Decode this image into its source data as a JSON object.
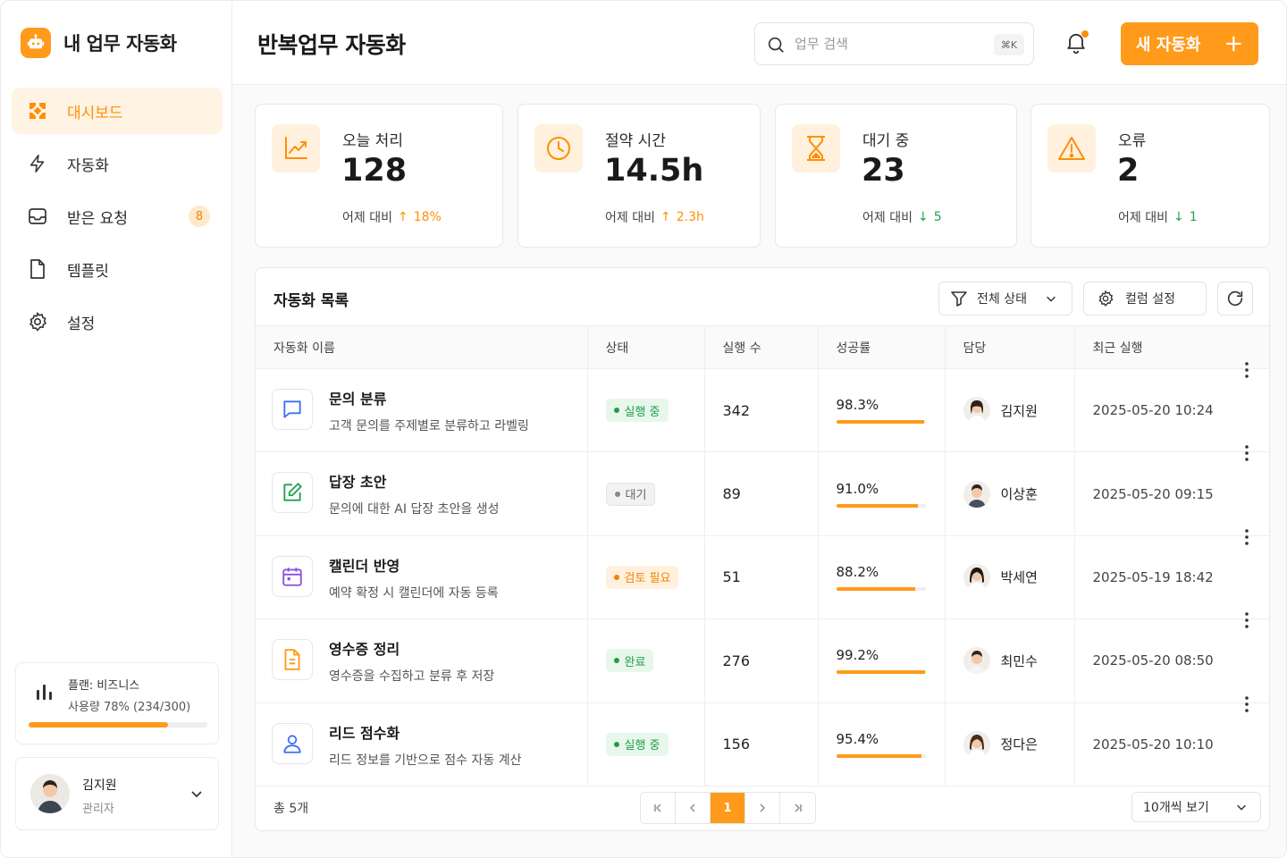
{
  "brand": {
    "title": "내 업무 자동화",
    "logo_icon": "robot-icon",
    "accent": "#ff9a1a"
  },
  "sidebar": {
    "items": [
      {
        "label": "대시보드",
        "icon": "dashboard-icon",
        "active": true
      },
      {
        "label": "자동화",
        "icon": "lightning-icon"
      },
      {
        "label": "받은 요청",
        "icon": "inbox-icon",
        "badge": "8"
      },
      {
        "label": "템플릿",
        "icon": "document-icon"
      },
      {
        "label": "설정",
        "icon": "gear-icon"
      }
    ],
    "plan": {
      "name": "플랜: 비즈니스",
      "usage": "사용량 78% (234/300)",
      "usage_fraction": 0.78
    },
    "user": {
      "name": "김지원",
      "role": "관리자"
    }
  },
  "header": {
    "title": "반복업무 자동화",
    "search_placeholder": "업무 검색",
    "search_shortcut": "⌘K",
    "new_button": "새 자동화",
    "new_button_icon": "+"
  },
  "stats": [
    {
      "label": "오늘 처리",
      "value": "128",
      "delta_label": "어제 대비",
      "delta": "18%",
      "direction": "up",
      "icon": "trend-up-icon"
    },
    {
      "label": "절약 시간",
      "value": "14.5h",
      "delta_label": "어제 대비",
      "delta": "2.3h",
      "direction": "up",
      "icon": "clock-icon"
    },
    {
      "label": "대기 중",
      "value": "23",
      "delta_label": "어제 대비",
      "delta": "5",
      "direction": "down",
      "icon": "hourglass-icon"
    },
    {
      "label": "오류",
      "value": "2",
      "delta_label": "어제 대비",
      "delta": "1",
      "direction": "down",
      "icon": "warning-icon"
    }
  ],
  "table": {
    "title": "자동화 목록",
    "filter_label": "전체 상태",
    "column_settings_label": "컬럼 설정",
    "columns": [
      "자동화 이름",
      "상태",
      "실행 수",
      "성공률",
      "담당",
      "최근 실행"
    ],
    "rows": [
      {
        "name": "문의 분류",
        "desc": "고객 문의를 주제별로 분류하고 라벨링",
        "icon": "chat-bubble-icon",
        "icon_color": "#3b6ff5",
        "status": "실행 중",
        "status_kind": "green",
        "runs": "342",
        "rate": "98.3%",
        "rate_fraction": 0.983,
        "owner": "김지원",
        "last_run": "2025-05-20 10:24"
      },
      {
        "name": "답장 초안",
        "desc": "문의에 대한 AI 답장 초안을 생성",
        "icon": "edit-icon",
        "icon_color": "#1fa24a",
        "status": "대기",
        "status_kind": "gray",
        "runs": "89",
        "rate": "91.0%",
        "rate_fraction": 0.91,
        "owner": "이상훈",
        "last_run": "2025-05-20 09:15"
      },
      {
        "name": "캘린더 반영",
        "desc": "예약 확정 시 캘린더에 자동 등록",
        "icon": "calendar-icon",
        "icon_color": "#8a4fe0",
        "status": "검토 필요",
        "status_kind": "orange",
        "runs": "51",
        "rate": "88.2%",
        "rate_fraction": 0.882,
        "owner": "박세연",
        "last_run": "2025-05-19 18:42"
      },
      {
        "name": "영수증 정리",
        "desc": "영수증을 수집하고 분류 후 저장",
        "icon": "receipt-icon",
        "icon_color": "#ff9a1a",
        "status": "완료",
        "status_kind": "green",
        "runs": "276",
        "rate": "99.2%",
        "rate_fraction": 0.992,
        "owner": "최민수",
        "last_run": "2025-05-20 08:50"
      },
      {
        "name": "리드 점수화",
        "desc": "리드 정보를 기반으로 점수 자동 계산",
        "icon": "user-icon",
        "icon_color": "#3b6ff5",
        "status": "실행 중",
        "status_kind": "green",
        "runs": "156",
        "rate": "95.4%",
        "rate_fraction": 0.954,
        "owner": "정다은",
        "last_run": "2025-05-20 10:10"
      }
    ],
    "footer": {
      "total": "총 5개",
      "pages": [
        "1"
      ],
      "current_page": "1",
      "per_page": "10개씩 보기"
    }
  }
}
